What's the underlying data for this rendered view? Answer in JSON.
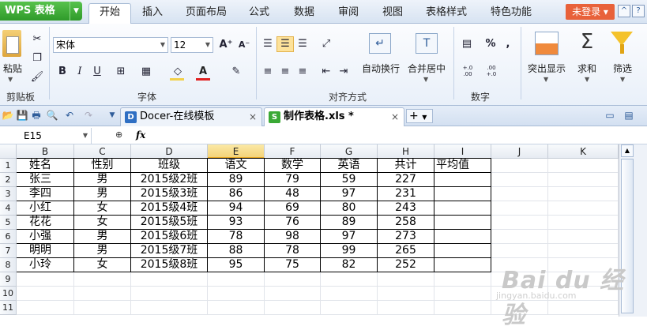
{
  "app": {
    "brand": "WPS 表格",
    "login_label": "未登录"
  },
  "menu": [
    "开始",
    "插入",
    "页面布局",
    "公式",
    "数据",
    "审阅",
    "视图",
    "表格样式",
    "特色功能"
  ],
  "ribbon": {
    "paste_label": "粘贴",
    "clipboard_group": "剪贴板",
    "font_name": "宋体",
    "font_size": "12",
    "font_group": "字体",
    "bold": "B",
    "italic": "I",
    "underline": "U",
    "align_group": "对齐方式",
    "wrap_label": "自动换行",
    "merge_label": "合并居中",
    "number_group": "数字",
    "percent": "%",
    "dec_inc": "+.0 .00",
    "dec_dec": ".00 +.0",
    "highlight_label": "突出显示",
    "sum_label": "求和",
    "filter_label": "筛选"
  },
  "tabs": [
    {
      "label": "Docer-在线模板",
      "active": false
    },
    {
      "label": "制作表格.xls *",
      "active": true
    }
  ],
  "formula_bar": {
    "cell_ref": "E15",
    "fx": "fx",
    "value": ""
  },
  "sheet": {
    "columns": [
      "B",
      "C",
      "D",
      "E",
      "F",
      "G",
      "H",
      "I",
      "J",
      "K"
    ],
    "selected_column": "E",
    "row_numbers": [
      "1",
      "2",
      "3",
      "4",
      "5",
      "6",
      "7",
      "8",
      "9",
      "10",
      "11"
    ],
    "rows": [
      [
        "姓名",
        "性别",
        "班级",
        "语文",
        "数学",
        "英语",
        "共计",
        "平均值"
      ],
      [
        "张三",
        "男",
        "2015级2班",
        "89",
        "79",
        "59",
        "227",
        ""
      ],
      [
        "李四",
        "男",
        "2015级3班",
        "86",
        "48",
        "97",
        "231",
        ""
      ],
      [
        "小红",
        "女",
        "2015级4班",
        "94",
        "69",
        "80",
        "243",
        ""
      ],
      [
        "花花",
        "女",
        "2015级5班",
        "93",
        "76",
        "89",
        "258",
        ""
      ],
      [
        "小强",
        "男",
        "2015级6班",
        "78",
        "98",
        "97",
        "273",
        ""
      ],
      [
        "明明",
        "男",
        "2015级7班",
        "88",
        "78",
        "99",
        "265",
        ""
      ],
      [
        "小玲",
        "女",
        "2015级8班",
        "95",
        "75",
        "82",
        "252",
        ""
      ]
    ]
  },
  "watermark": {
    "main": "Bai du 经验",
    "sub": "jingyan.baidu.com"
  },
  "colors": {
    "accent_green": "#3aa935",
    "login_orange": "#e8613a",
    "selected_col": "#f4d37a"
  }
}
